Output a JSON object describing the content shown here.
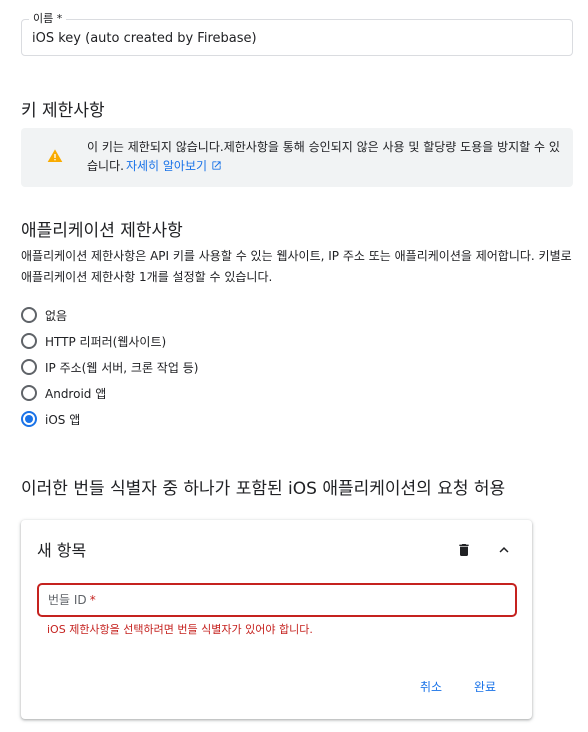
{
  "name_field": {
    "label": "이름 *",
    "value": "iOS key (auto created by Firebase)"
  },
  "key_restrictions": {
    "title": "키 제한사항",
    "warning": {
      "text": "이 키는 제한되지 않습니다.제한사항을 통해 승인되지 않은 사용 및 할당량 도용을 방지할 수 있습니다.",
      "link_label": "자세히 알아보기",
      "icon": "warning-icon",
      "icon_color": "#f9ab00"
    }
  },
  "app_restrictions": {
    "title": "애플리케이션 제한사항",
    "description": "애플리케이션 제한사항은 API 키를 사용할 수 있는 웹사이트, IP 주소 또는 애플리케이션을 제어합니다. 키별로 애플리케이션 제한사항 1개를 설정할 수 있습니다.",
    "options": [
      {
        "label": "없음",
        "checked": false
      },
      {
        "label": "HTTP 리퍼러(웹사이트)",
        "checked": false
      },
      {
        "label": "IP 주소(웹 서버, 크론 작업 등)",
        "checked": false
      },
      {
        "label": "Android 앱",
        "checked": false
      },
      {
        "label": "iOS 앱",
        "checked": true
      }
    ]
  },
  "bundle_section": {
    "title": "이러한 번들 식별자 중 하나가 포함된 iOS 애플리케이션의 요청 허용",
    "card": {
      "title": "새 항목",
      "field_placeholder": "번들 ID",
      "required_mark": "*",
      "error": "iOS 제한사항을 선택하려면 번들 식별자가 있어야 합니다.",
      "cancel_label": "취소",
      "done_label": "완료"
    }
  },
  "colors": {
    "accent": "#1a73e8",
    "error": "#c5221f",
    "banner_bg": "#f1f3f4"
  }
}
